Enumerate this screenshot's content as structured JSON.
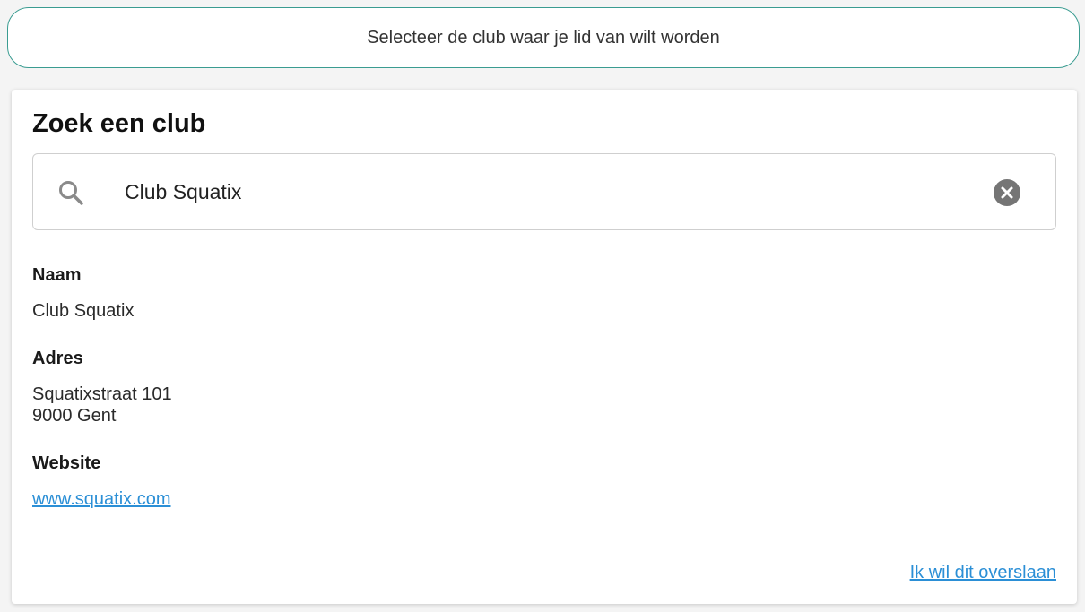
{
  "banner": {
    "text": "Selecteer de club waar je lid van wilt worden"
  },
  "search_card": {
    "title": "Zoek een club",
    "search": {
      "value": "Club Squatix",
      "icon": "search-icon",
      "clear_icon": "clear-icon"
    },
    "details": {
      "name_label": "Naam",
      "name_value": "Club Squatix",
      "address_label": "Adres",
      "address_line1": "Squatixstraat 101",
      "address_line2": "9000 Gent",
      "website_label": "Website",
      "website_value": "www.squatix.com"
    },
    "skip_link": "Ik wil dit overslaan"
  },
  "colors": {
    "accent_border": "#3a9c91",
    "link": "#2b8fd6",
    "clear_icon": "#757575"
  }
}
